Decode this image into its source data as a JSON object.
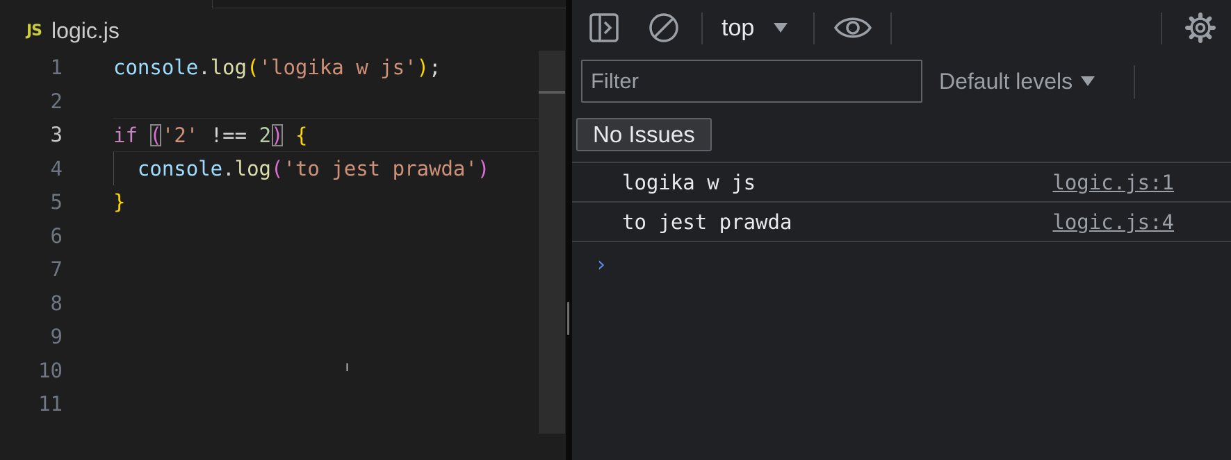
{
  "editor": {
    "tab": {
      "badge": "JS",
      "filename": "logic.js"
    },
    "line_numbers": [
      "1",
      "2",
      "3",
      "4",
      "5",
      "6",
      "7",
      "8",
      "9",
      "10",
      "11"
    ],
    "active_line": "3",
    "code": {
      "l1": {
        "obj": "console",
        "dot": ".",
        "fn": "log",
        "open": "(",
        "str": "'logika w js'",
        "close": ")",
        "semi": ";"
      },
      "l3": {
        "kw": "if",
        "open": "(",
        "str": "'2'",
        "op": " !== ",
        "num": "2",
        "close": ")",
        "brace": "{"
      },
      "l4": {
        "obj": "console",
        "dot": ".",
        "fn": "log",
        "open": "(",
        "str": "'to jest prawda'",
        "close": ")"
      },
      "l5": {
        "brace": "}"
      }
    }
  },
  "devtools": {
    "toolbar": {
      "context": "top",
      "icons": [
        "sidebar-toggle-icon",
        "clear-console-icon",
        "eye-icon",
        "gear-icon"
      ]
    },
    "filter": {
      "placeholder": "Filter",
      "value": ""
    },
    "levels_label": "Default levels",
    "issues_label": "No Issues",
    "logs": [
      {
        "message": "logika w js",
        "source": "logic.js:1"
      },
      {
        "message": "to jest prawda",
        "source": "logic.js:4"
      }
    ],
    "prompt_symbol": "›"
  },
  "colors": {
    "editor_bg": "#1e1e1e",
    "devtools_bg": "#202124",
    "string": "#ce9178",
    "keyword": "#c586c0",
    "function": "#dcdcaa",
    "variable": "#9cdcfe",
    "number": "#b5cea8",
    "prompt": "#5c8ce8"
  }
}
